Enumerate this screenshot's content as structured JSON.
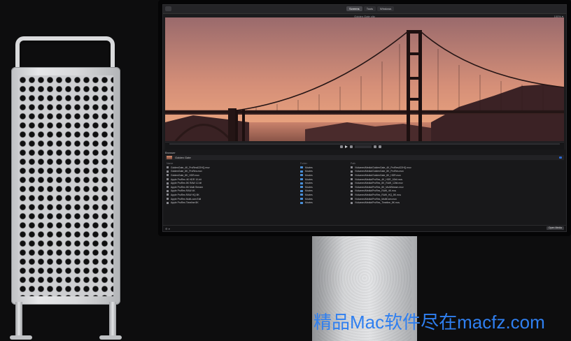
{
  "app": {
    "tabs": [
      {
        "label": "Screens",
        "active": true
      },
      {
        "label": "Tools",
        "active": false
      },
      {
        "label": "Windows",
        "active": false
      }
    ],
    "subtitle": "Golden Gate clip",
    "top_right": "100% ▾"
  },
  "browser": {
    "header": "Browser",
    "bar_name": "Golden Gate",
    "column_headers": [
      "Name",
      "Folder",
      "Path"
    ],
    "files": [
      "GoldenGate_4K_ProRes422HQ.mov",
      "GoldenGate_8K_ProRes.mov",
      "GoldenGate_8K_HDR.mov",
      "Apple ProRes 4K HDR 10-bit",
      "Apple ProRes 8K RAW 12-bit",
      "Apple ProRes 8K Multi Stream",
      "Apple ProRes RAW 4K",
      "Apple ProRes RAW HQ 8K",
      "Apple ProRes Multi-cam Edit",
      "Apple ProRes Timeline 8K"
    ],
    "folders": [
      "Movies",
      "Movies",
      "Movies",
      "Movies",
      "Movies",
      "Movies",
      "Movies",
      "Movies",
      "Movies",
      "Movies"
    ],
    "paths": [
      "/Volumes/Media/GoldenGate_4K_ProRes422HQ.mov",
      "/Volumes/Media/GoldenGate_8K_ProRes.mov",
      "/Volumes/Media/GoldenGate_8K_HDR.mov",
      "/Volumes/Media/ProRes_4K_HDR_10bit.mov",
      "/Volumes/Media/ProRes_8K_RAW_12bit.mov",
      "/Volumes/Media/ProRes_8K_MultiStream.mov",
      "/Volumes/Media/ProRes_RAW_4K.mov",
      "/Volumes/Media/ProRes_RAW_HQ_8K.mov",
      "/Volumes/Media/ProRes_MultiCam.mov",
      "/Volumes/Media/ProRes_Timeline_8K.mov"
    ]
  },
  "footer": {
    "left": "⚙ ▾",
    "button": "Open Media"
  },
  "watermark": "精品Mac软件尽在macfz.com",
  "colors": {
    "accent": "#2d6ad6",
    "watermark": "#2f7ff0",
    "sky_top": "#a86e6b",
    "sky_bottom": "#e9a07b"
  }
}
